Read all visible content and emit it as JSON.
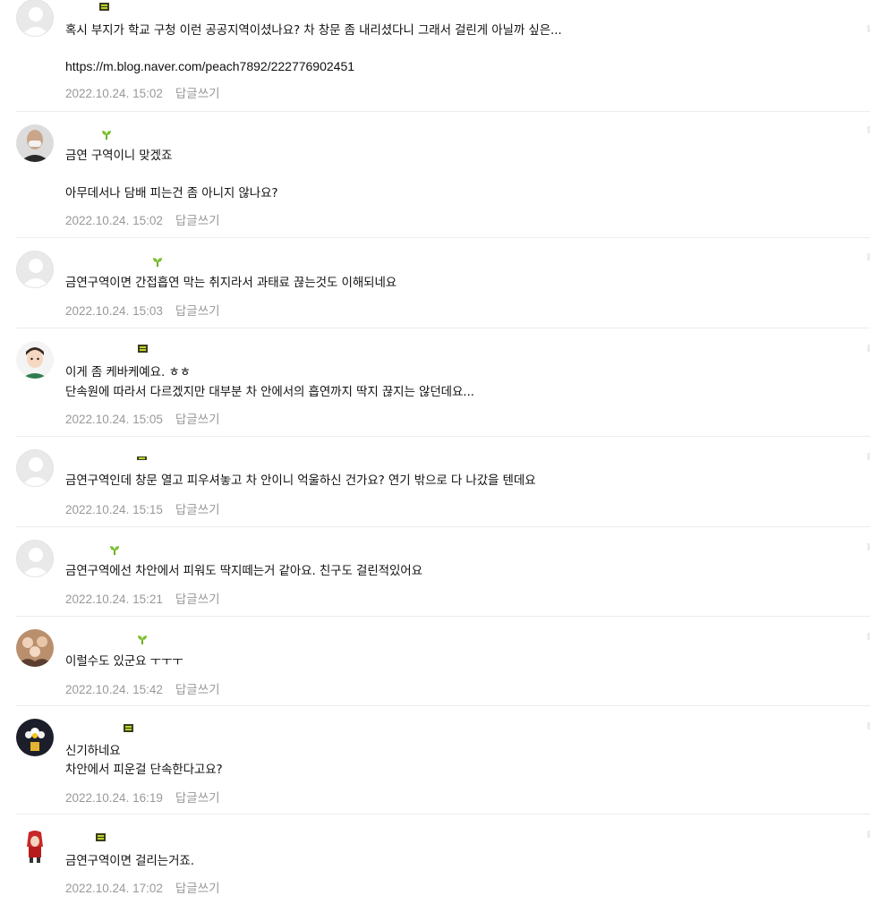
{
  "reply_label": "답글쓰기",
  "colors": {
    "level_badge": "#bcd32a",
    "sprout_badge": "#7cbf2f",
    "date": "#999999",
    "divider": "#ececec"
  },
  "comments": [
    {
      "avatar": "default-avatar-icon",
      "badge": "level-badge",
      "lines": [
        "혹시 부지가 학교 구청 이런 공공지역이셨나요? 차 창문 좀 내리셨다니 그래서 걸린게 아닐까 싶은..."
      ],
      "link": "https://m.blog.naver.com/peach7892/222776902451",
      "date": "2022.10.24. 15:02"
    },
    {
      "avatar": "bald-man-avatar",
      "badge": "sprout-badge",
      "lines": [
        "금연 구역이니 맞겠죠",
        "",
        "아무데서나 담배 피는건 좀 아니지 않나요?"
      ],
      "date": "2022.10.24. 15:02"
    },
    {
      "avatar": "default-avatar-icon",
      "badge": "sprout-badge",
      "lines": [
        "금연구역이면 간접흡연 막는 취지라서 과태료 끊는것도 이해되네요"
      ],
      "date": "2022.10.24. 15:03"
    },
    {
      "avatar": "cartoon-boy-avatar",
      "badge": "level-badge",
      "lines": [
        "이게 좀 케바케예요. ㅎㅎ",
        "단속원에 따라서 다르겠지만 대부분 차 안에서의 흡연까지 딱지 끊지는 않던데요..."
      ],
      "date": "2022.10.24. 15:05"
    },
    {
      "avatar": "default-avatar-icon",
      "badge": "level-badge-thin",
      "lines": [
        "금연구역인데 창문 열고 피우셔놓고 차 안이니 억울하신 건가요? 연기 밖으로 다 나갔을 텐데요"
      ],
      "date": "2022.10.24. 15:15"
    },
    {
      "avatar": "default-avatar-icon",
      "badge": "sprout-badge",
      "lines": [
        "금연구역에선 차안에서 피워도 딱지떼는거 같아요. 친구도 걸린적있어요"
      ],
      "date": "2022.10.24. 15:21"
    },
    {
      "avatar": "group-photo-avatar",
      "badge": "sprout-badge",
      "lines": [
        "이럴수도 있군요 ㅜㅜㅜ"
      ],
      "date": "2022.10.24. 15:42"
    },
    {
      "avatar": "flower-avatar",
      "badge": "level-badge",
      "lines": [
        "신기하네요",
        "차안에서 피운걸 단속한다고요?"
      ],
      "date": "2022.10.24. 16:19"
    },
    {
      "avatar": "red-character-avatar",
      "badge": "level-badge",
      "lines": [
        "금연구역이면 걸리는거죠."
      ],
      "date": "2022.10.24. 17:02"
    }
  ]
}
